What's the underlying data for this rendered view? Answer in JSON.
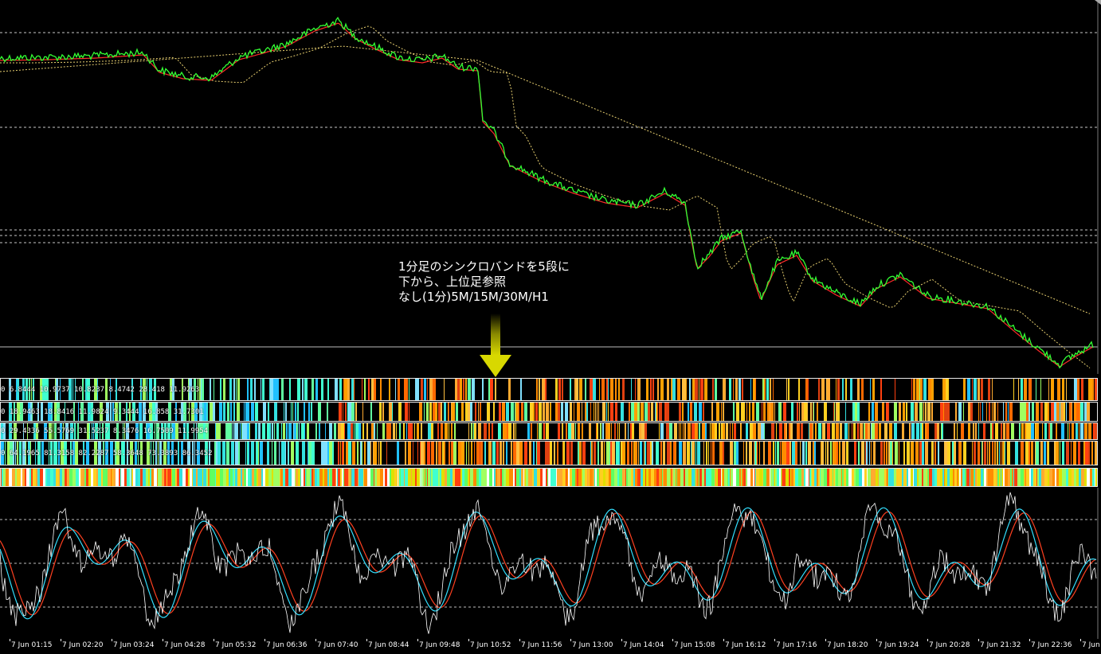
{
  "annotation": {
    "line1": "1分足のシンクロバンドを5段に",
    "line2": "下から、上位足参照",
    "line3": "なし(1分)5M/15M/30M/H1"
  },
  "bands": [
    {
      "label": "0 6.8444 10.9737 10.8237 8.4742 28.418 11.9263",
      "scheme": "hot-cyan",
      "density": 0.55
    },
    {
      "label": "0 18.9463 18.8416 11.9824 9.3444 16.858 31.7301",
      "scheme": "hot-cyan",
      "density": 0.7
    },
    {
      "label": "0 29.4336 55.5769 31.5237 8.3476 16.7509 11.9954",
      "scheme": "hot-cyan",
      "density": 0.75
    },
    {
      "label": "0 64.1965 81.3158 82.2287 58.3648 73.3893 86.3452",
      "scheme": "hot-cyan",
      "density": 0.85
    },
    {
      "label": "",
      "scheme": "full",
      "density": 1.0
    }
  ],
  "time_axis": [
    "7 Jun 01:15",
    "7 Jun 02:20",
    "7 Jun 03:24",
    "7 Jun 04:28",
    "7 Jun 05:32",
    "7 Jun 06:36",
    "7 Jun 07:40",
    "7 Jun 08:44",
    "7 Jun 09:48",
    "7 Jun 10:52",
    "7 Jun 11:56",
    "7 Jun 13:00",
    "7 Jun 14:04",
    "7 Jun 15:08",
    "7 Jun 16:12",
    "7 Jun 17:16",
    "7 Jun 18:20",
    "7 Jun 19:24",
    "7 Jun 20:28",
    "7 Jun 21:32",
    "7 Jun 22:36",
    "7 Jun"
  ],
  "colors": {
    "background": "#000000",
    "price": "#33ff33",
    "fast_ma": "#ff2a2a",
    "slow_ma": "#e8d070",
    "stoch_main": "#ffffff",
    "stoch_signal_a": "#33e0ff",
    "stoch_signal_b": "#ff4020",
    "arrow": "#c8c800"
  },
  "icons": {
    "arrow": "down-arrow-icon",
    "corner": "scroll-corner-icon"
  }
}
